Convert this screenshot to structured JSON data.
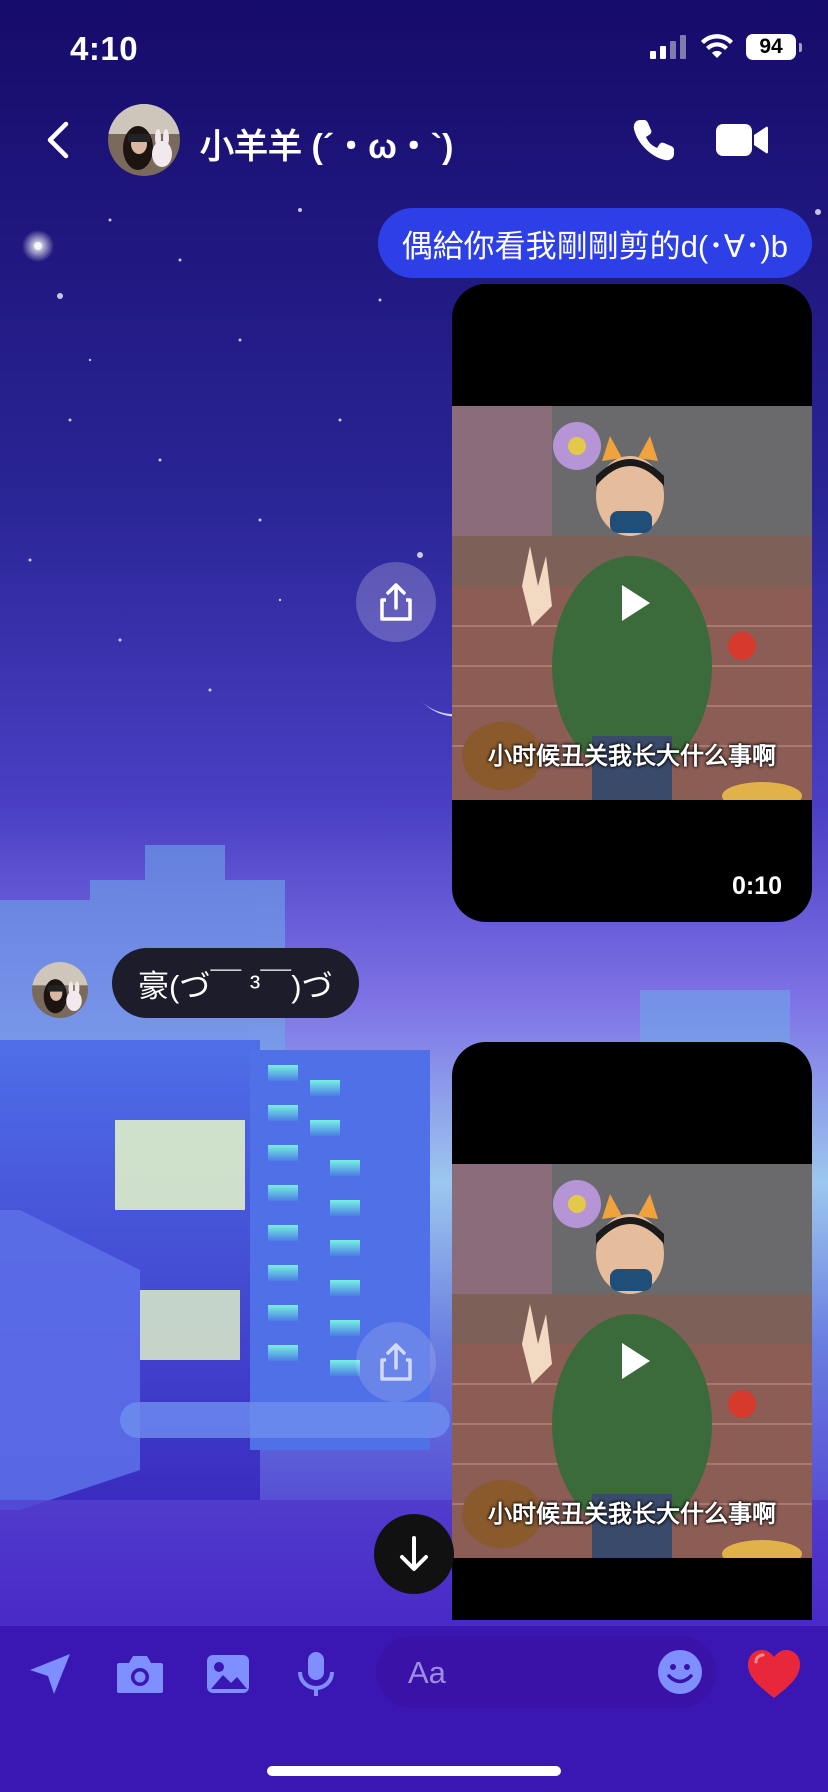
{
  "status_bar": {
    "time": "4:10",
    "battery": "94"
  },
  "header": {
    "contact_name": "小羊羊 (´・ω・`)"
  },
  "messages": {
    "outgoing_text": "偶給你看我剛剛剪的d(･∀･)b",
    "video1_caption": "小时候丑关我长大什么事啊",
    "video1_duration": "0:10",
    "incoming_text": "豪(づ￣ ³￣)づ",
    "video2_caption": "小时候丑关我长大什么事啊"
  },
  "composer": {
    "placeholder": "Aa"
  },
  "colors": {
    "accent": "#2d3fe6",
    "background": "#1a0a6e",
    "composer_field": "#3b12a8",
    "heart": "#e8283a"
  },
  "icons": [
    "back-icon",
    "phone-icon",
    "video-camera-icon",
    "share-icon",
    "play-icon",
    "arrow-down-icon",
    "location-arrow-icon",
    "camera-icon",
    "image-icon",
    "microphone-icon",
    "emoji-icon",
    "heart-icon"
  ]
}
